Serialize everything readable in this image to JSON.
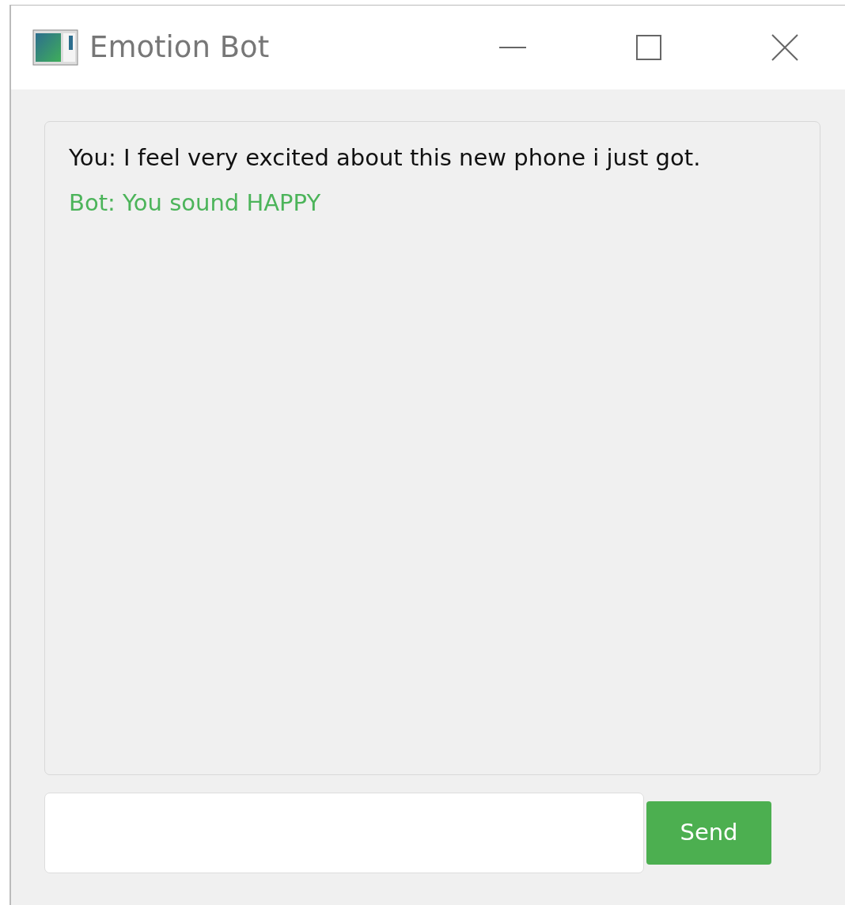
{
  "window": {
    "title": "Emotion Bot"
  },
  "messages": [
    {
      "kind": "user",
      "text": "You: I feel very excited about this new phone i just got."
    },
    {
      "kind": "bot",
      "text": "Bot: You sound HAPPY"
    }
  ],
  "send_button": {
    "label": "Send"
  }
}
